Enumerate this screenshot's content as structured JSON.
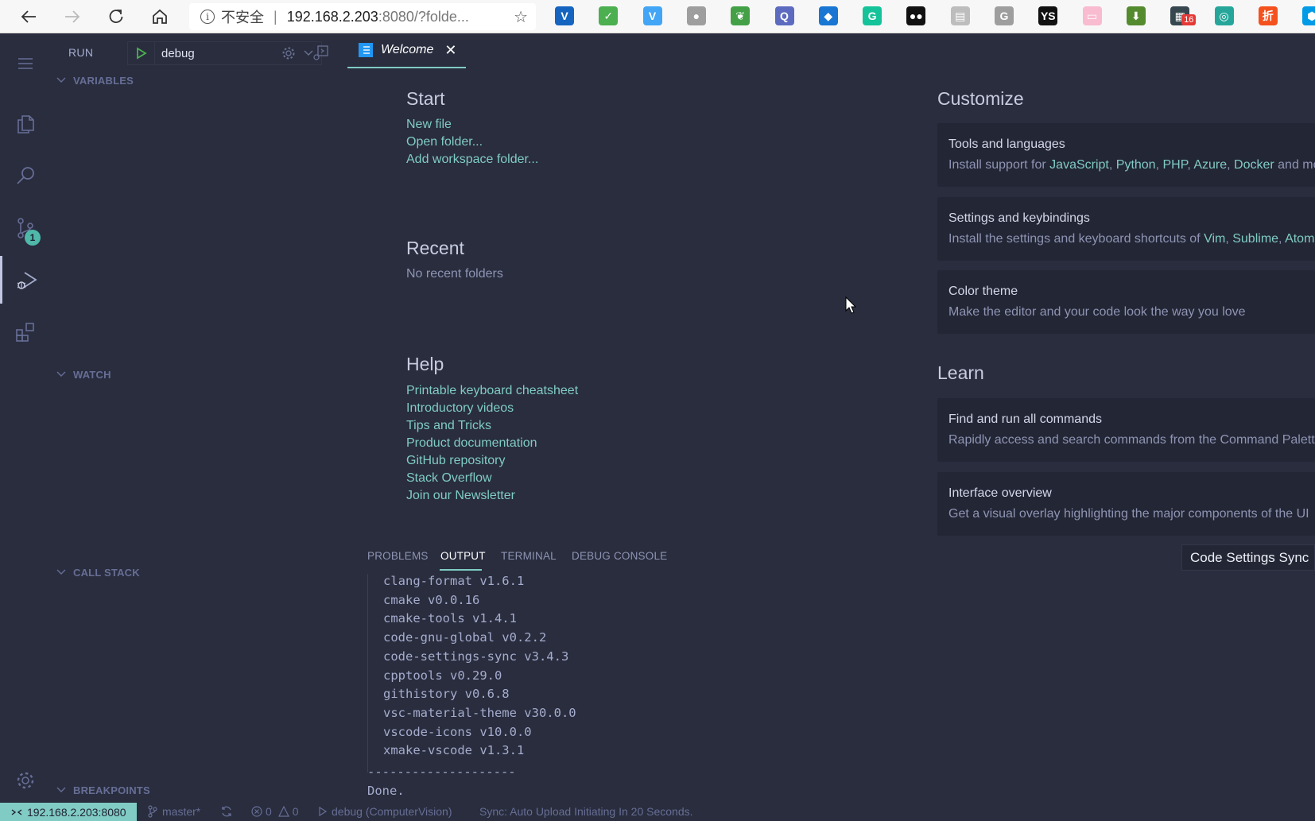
{
  "browser": {
    "security_label": "不安全",
    "url_host": "192.168.2.203",
    "url_rest": ":8080/?folde...",
    "nav": {
      "back": "back-arrow-icon",
      "forward": "forward-arrow-icon",
      "reload": "reload-icon",
      "home": "home-icon"
    },
    "extensions": [
      {
        "name": "vpn-extension-icon",
        "color": "#1565c0",
        "glyph": "V"
      },
      {
        "name": "adguard-extension-icon",
        "color": "#4caf50",
        "glyph": "✓"
      },
      {
        "name": "vimium-extension-icon",
        "color": "#42a5f5",
        "glyph": "V"
      },
      {
        "name": "gray-circle-extension-icon",
        "color": "#9e9e9e",
        "glyph": "●"
      },
      {
        "name": "leaf-extension-icon",
        "color": "#43a047",
        "glyph": "❦"
      },
      {
        "name": "search-magnifier-extension-icon",
        "color": "#5c6bc0",
        "glyph": "Q"
      },
      {
        "name": "diamond-extension-icon",
        "color": "#1976d2",
        "glyph": "◆"
      },
      {
        "name": "grammarly-extension-icon",
        "color": "#15c39a",
        "glyph": "G"
      },
      {
        "name": "tampermonkey-extension-icon",
        "color": "#111111",
        "glyph": "●●"
      },
      {
        "name": "document-extension-icon",
        "color": "#bdbdbd",
        "glyph": "▤"
      },
      {
        "name": "translate-extension-icon",
        "color": "#9e9e9e",
        "glyph": "G"
      },
      {
        "name": "ys-extension-icon",
        "color": "#111111",
        "glyph": "YS"
      },
      {
        "name": "bilibili-extension-icon",
        "color": "#f8bbd0",
        "glyph": "▭"
      },
      {
        "name": "download-extension-icon",
        "color": "#558b2f",
        "glyph": "⬇"
      },
      {
        "name": "apps-extension-icon",
        "color": "#37474f",
        "glyph": "▦",
        "badge": "16"
      },
      {
        "name": "green-circle-extension-icon",
        "color": "#26a69a",
        "glyph": "◎"
      },
      {
        "name": "discount-extension-icon",
        "color": "#f4511e",
        "glyph": "折"
      },
      {
        "name": "hexagon-extension-icon",
        "color": "#039be5",
        "glyph": "⬢"
      }
    ]
  },
  "activity_bar": {
    "scm_badge": "1"
  },
  "sidebar": {
    "title": "RUN",
    "debug_config": "debug",
    "sections": {
      "variables": "VARIABLES",
      "watch": "WATCH",
      "call_stack": "CALL STACK",
      "breakpoints": "BREAKPOINTS"
    }
  },
  "editor": {
    "tab_label": "Welcome"
  },
  "welcome": {
    "start": {
      "heading": "Start",
      "links": [
        "New file",
        "Open folder...",
        "Add workspace folder..."
      ]
    },
    "recent": {
      "heading": "Recent",
      "empty_text": "No recent folders"
    },
    "help": {
      "heading": "Help",
      "links": [
        "Printable keyboard cheatsheet",
        "Introductory videos",
        "Tips and Tricks",
        "Product documentation",
        "GitHub repository",
        "Stack Overflow",
        "Join our Newsletter"
      ]
    },
    "customize": {
      "heading": "Customize",
      "cards": [
        {
          "title": "Tools and languages",
          "desc_prefix": "Install support for ",
          "links": [
            "JavaScript",
            "Python",
            "PHP",
            "Azure",
            "Docker"
          ],
          "desc_suffix": " and mo"
        },
        {
          "title": "Settings and keybindings",
          "desc_prefix": "Install the settings and keyboard shortcuts of ",
          "links": [
            "Vim",
            "Sublime",
            "Atom"
          ],
          "desc_suffix": ""
        },
        {
          "title": "Color theme",
          "desc": "Make the editor and your code look the way you love"
        }
      ]
    },
    "learn": {
      "heading": "Learn",
      "cards": [
        {
          "title": "Find and run all commands",
          "desc": "Rapidly access and search commands from the Command Palette"
        },
        {
          "title": "Interface overview",
          "desc": "Get a visual overlay highlighting the major components of the UI"
        }
      ]
    },
    "sync_button": "Code Settings Sync"
  },
  "panel": {
    "tabs": [
      "PROBLEMS",
      "OUTPUT",
      "TERMINAL",
      "DEBUG CONSOLE"
    ],
    "active_tab": "OUTPUT",
    "output_lines": [
      "clang-format v1.6.1",
      "cmake v0.0.16",
      "cmake-tools v1.4.1",
      "code-gnu-global v0.2.2",
      "code-settings-sync v3.4.3",
      "cpptools v0.29.0",
      "githistory v0.6.8",
      "vsc-material-theme v30.0.0",
      "vscode-icons v10.0.0",
      "xmake-vscode v1.3.1"
    ],
    "separator": "--------------------",
    "done": "Done."
  },
  "status_bar": {
    "remote": "192.168.2.203:8080",
    "branch": "master*",
    "errors": "0",
    "warnings": "0",
    "debug_target": "debug (ComputerVision)",
    "sync_message": "Sync: Auto Upload Initiating In 20 Seconds."
  },
  "colors": {
    "background": "#292d3e",
    "accent": "#80cbc4",
    "card": "#232635"
  }
}
